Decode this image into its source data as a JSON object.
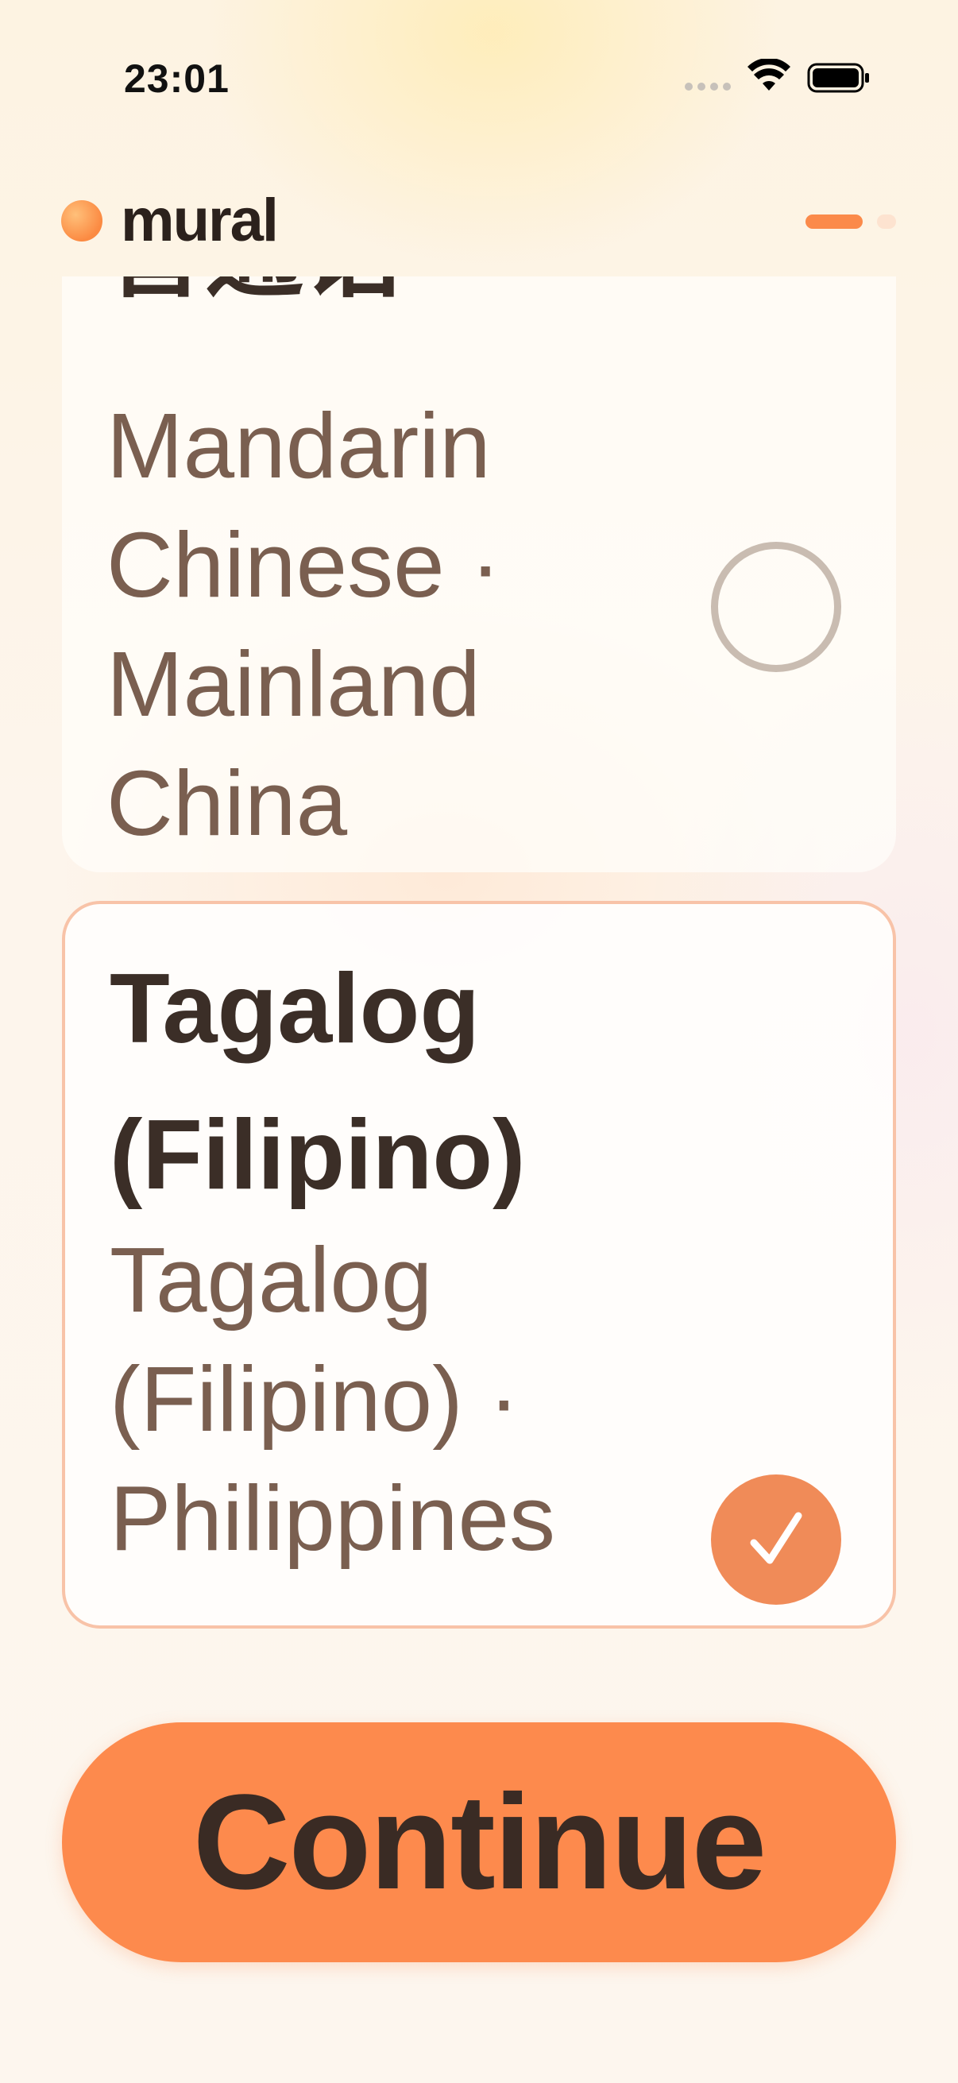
{
  "status_bar": {
    "time": "23:01"
  },
  "header": {
    "logo_text": "mural"
  },
  "languages": [
    {
      "title": "普通话",
      "subtitle": "Mandarin Chinese · Mainland China",
      "selected": false
    },
    {
      "title": "Tagalog (Filipino)",
      "subtitle": "Tagalog (Filipino) · Philippines",
      "selected": true
    }
  ],
  "cta": {
    "label": "Continue"
  },
  "colors": {
    "accent": "#fd8a4d",
    "check_fill": "#f08b58",
    "text_dark": "#3b2e27",
    "text_muted": "#7a5f50"
  }
}
